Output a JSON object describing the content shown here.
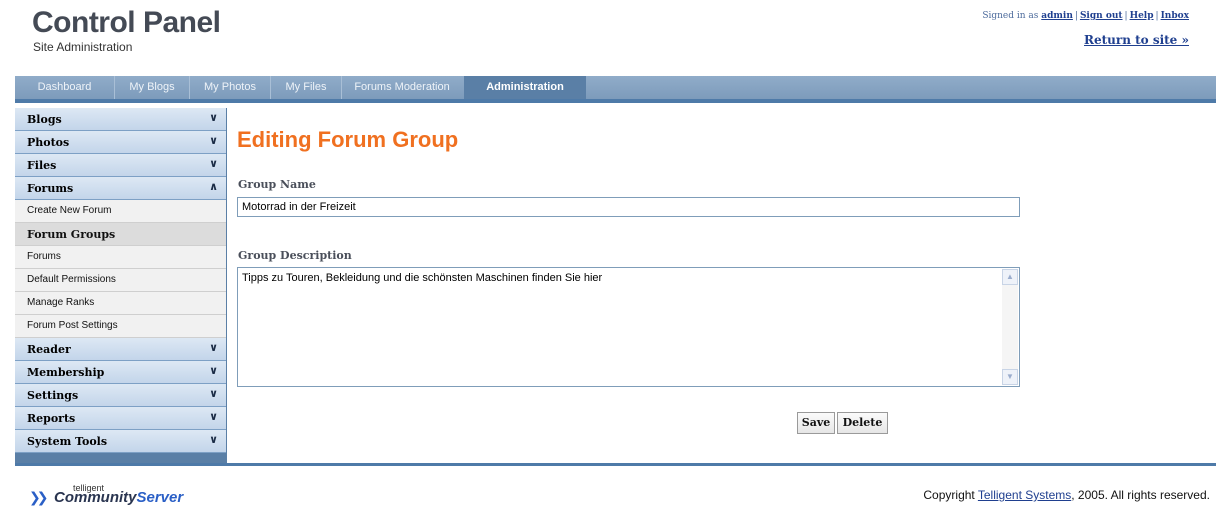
{
  "header": {
    "title": "Control Panel",
    "subtitle": "Site Administration",
    "signed_in_prefix": "Signed in as",
    "username": "admin",
    "sign_out": "Sign out",
    "help": "Help",
    "inbox": "Inbox",
    "return_to_site": "Return to site »"
  },
  "nav": {
    "tabs": [
      {
        "label": "Dashboard"
      },
      {
        "label": "My Blogs"
      },
      {
        "label": "My Photos"
      },
      {
        "label": "My Files"
      },
      {
        "label": "Forums Moderation"
      },
      {
        "label": "Administration",
        "active": true
      }
    ]
  },
  "sidebar": {
    "sections": [
      {
        "label": "Blogs",
        "chevron": "chevron-down-icon"
      },
      {
        "label": "Photos",
        "chevron": "chevron-down-icon"
      },
      {
        "label": "Files",
        "chevron": "chevron-down-icon"
      },
      {
        "label": "Forums",
        "chevron": "chevron-up-icon",
        "expanded": true
      },
      {
        "label": "Reader",
        "chevron": "chevron-down-icon"
      },
      {
        "label": "Membership",
        "chevron": "chevron-down-icon"
      },
      {
        "label": "Settings",
        "chevron": "chevron-down-icon"
      },
      {
        "label": "Reports",
        "chevron": "chevron-down-icon"
      },
      {
        "label": "System Tools",
        "chevron": "chevron-down-icon"
      }
    ],
    "forum_items": [
      {
        "label": "Create New Forum"
      },
      {
        "label": "Forum Groups",
        "selected": true
      },
      {
        "label": "Forums"
      },
      {
        "label": "Default Permissions"
      },
      {
        "label": "Manage Ranks"
      },
      {
        "label": "Forum Post Settings"
      }
    ]
  },
  "main": {
    "title": "Editing Forum Group",
    "group_name_label": "Group Name",
    "group_name_value": "Motorrad in der Freizeit",
    "group_description_label": "Group Description",
    "group_description_value": "Tipps zu Touren, Bekleidung und die schönsten Maschinen finden Sie hier",
    "save_label": "Save",
    "delete_label": "Delete"
  },
  "footer": {
    "logo_small": "telligent",
    "logo_community": "Community",
    "logo_server": "Server",
    "copyright_prefix": "Copyright",
    "copyright_link": "Telligent Systems",
    "copyright_suffix": ", 2005. All rights reserved."
  },
  "colors": {
    "accent_title": "#f07020",
    "nav_bar": "#7d9bbb",
    "link": "#1f3f8f"
  }
}
